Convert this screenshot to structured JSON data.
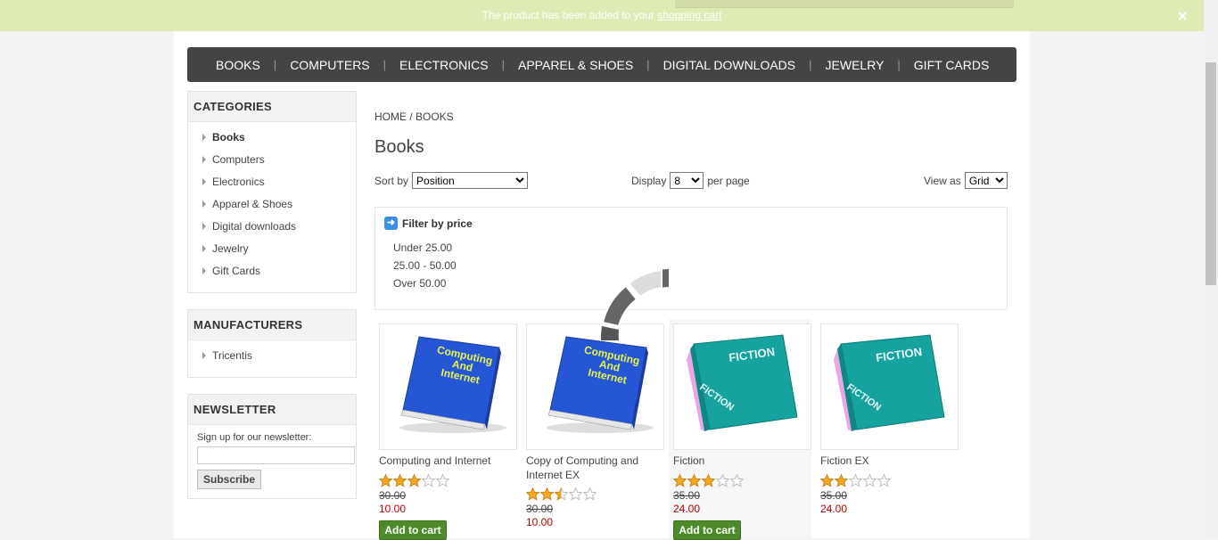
{
  "notification": {
    "message": "The product has been added to your",
    "link_text": "shopping cart",
    "close_glyph": "×"
  },
  "top_menu": [
    "BOOKS",
    "COMPUTERS",
    "ELECTRONICS",
    "APPAREL & SHOES",
    "DIGITAL DOWNLOADS",
    "JEWELRY",
    "GIFT CARDS"
  ],
  "categories": {
    "title": "CATEGORIES",
    "items": [
      "Books",
      "Computers",
      "Electronics",
      "Apparel & Shoes",
      "Digital downloads",
      "Jewelry",
      "Gift Cards"
    ],
    "active": "Books"
  },
  "manufacturers": {
    "title": "MANUFACTURERS",
    "items": [
      "Tricentis"
    ]
  },
  "newsletter": {
    "title": "NEWSLETTER",
    "label": "Sign up for our newsletter:",
    "email_value": "",
    "button": "Subscribe"
  },
  "breadcrumb": {
    "home": "HOME",
    "separator": " / ",
    "current": "BOOKS"
  },
  "page_title": "Books",
  "sort": {
    "label": "Sort by",
    "selected": "Position"
  },
  "display": {
    "label": "Display",
    "selected": "8",
    "suffix": "per page"
  },
  "view": {
    "label": "View as",
    "selected": "Grid"
  },
  "price_filter": {
    "title": "Filter by price",
    "ranges": [
      "Under 25.00",
      "25.00 - 50.00",
      "Over 50.00"
    ]
  },
  "products": [
    {
      "title": "Computing and Internet",
      "rating": 3,
      "old_price": "30.00",
      "price": "10.00",
      "has_add_to_cart": true,
      "cover": "computing"
    },
    {
      "title": "Copy of Computing and Internet EX",
      "rating": 2.5,
      "old_price": "30.00",
      "price": "10.00",
      "has_add_to_cart": false,
      "cover": "computing"
    },
    {
      "title": "Fiction",
      "rating": 3,
      "old_price": "35.00",
      "price": "24.00",
      "has_add_to_cart": true,
      "cover": "fiction"
    },
    {
      "title": "Fiction EX",
      "rating": 2,
      "old_price": "35.00",
      "price": "24.00",
      "has_add_to_cart": false,
      "cover": "fiction"
    }
  ],
  "add_to_cart_label": "Add to cart",
  "cover_text": {
    "computing": [
      "Computing",
      "And",
      "Internet"
    ],
    "fiction": "FICTION"
  },
  "colors": {
    "notification_bg": "#dfebb5",
    "menu_bg": "#444444",
    "add_to_cart_bg": "#4d8b2a",
    "price": "#b30000",
    "star": "#f5a623",
    "book_blue": "#2456d6",
    "book_teal": "#16a3a0"
  }
}
